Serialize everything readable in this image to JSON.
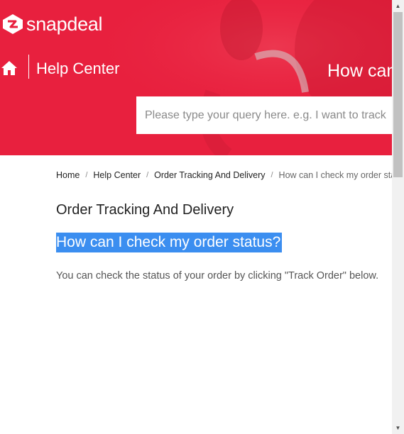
{
  "brand": {
    "logo_text": "snapdeal",
    "primary_color": "#e8203e"
  },
  "header": {
    "home_icon": "home-icon",
    "section_title": "Help Center",
    "hero_heading": "How can",
    "search": {
      "placeholder": "Please type your query here. e.g. I want to track",
      "value": ""
    }
  },
  "breadcrumb": {
    "items": [
      {
        "label": "Home"
      },
      {
        "label": "Help Center"
      },
      {
        "label": "Order Tracking And Delivery"
      },
      {
        "label": "How can I check my order status?"
      }
    ],
    "separator": "/"
  },
  "article": {
    "category": "Order Tracking And Delivery",
    "question": "How can I check my order status?",
    "highlight_color": "#3b8ef0",
    "answer": "You can check the status of your order by clicking \"Track Order\" below."
  }
}
